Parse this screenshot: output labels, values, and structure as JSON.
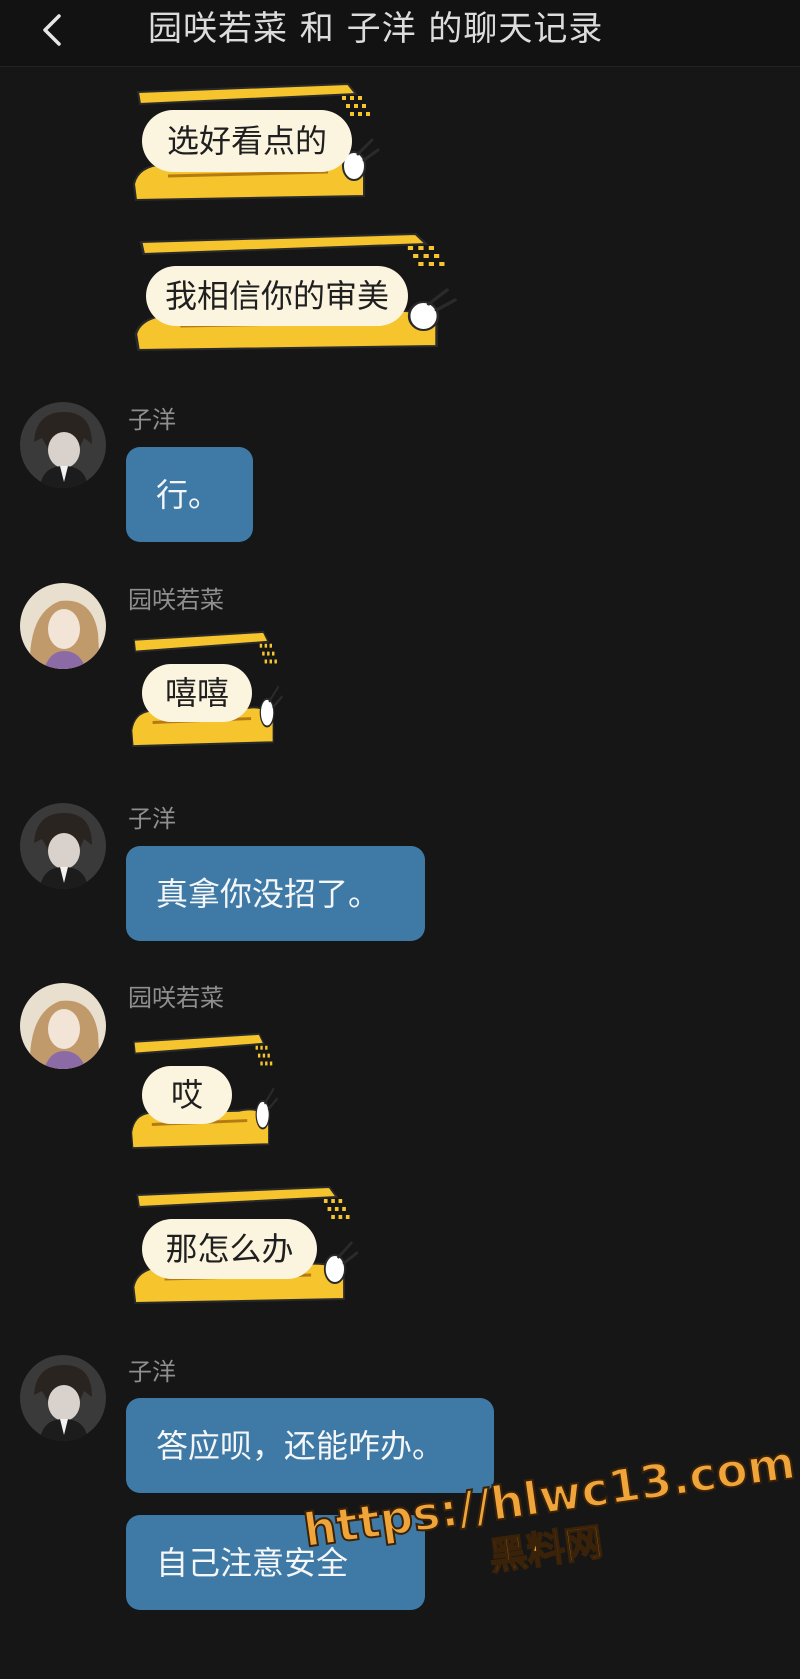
{
  "header": {
    "title": "园咲若菜 和 子洋 的聊天记录",
    "back_icon": "chevron-left-icon"
  },
  "colors": {
    "background": "#161616",
    "outgoing_bubble": "#3f7aa6",
    "sticker_yellow": "#f6c42c",
    "sender_name": "#8f8f8f"
  },
  "messages": [
    {
      "sender": "",
      "type": "sticker",
      "text": "选好看点的"
    },
    {
      "sender": "",
      "type": "sticker",
      "text": "我相信你的审美"
    },
    {
      "sender": "子洋",
      "type": "text",
      "text": "行。"
    },
    {
      "sender": "园咲若菜",
      "type": "sticker",
      "text": "嘻嘻"
    },
    {
      "sender": "子洋",
      "type": "text",
      "text": "真拿你没招了。"
    },
    {
      "sender": "园咲若菜",
      "type": "sticker",
      "text": "哎"
    },
    {
      "sender": "",
      "type": "sticker",
      "text": "那怎么办"
    },
    {
      "sender": "子洋",
      "type": "text",
      "text": "答应呗，还能咋办。"
    },
    {
      "sender": "",
      "type": "text",
      "text": "自己注意安全"
    }
  ],
  "watermark": {
    "url": "https://hlwc13.com",
    "site": "黑料网"
  }
}
